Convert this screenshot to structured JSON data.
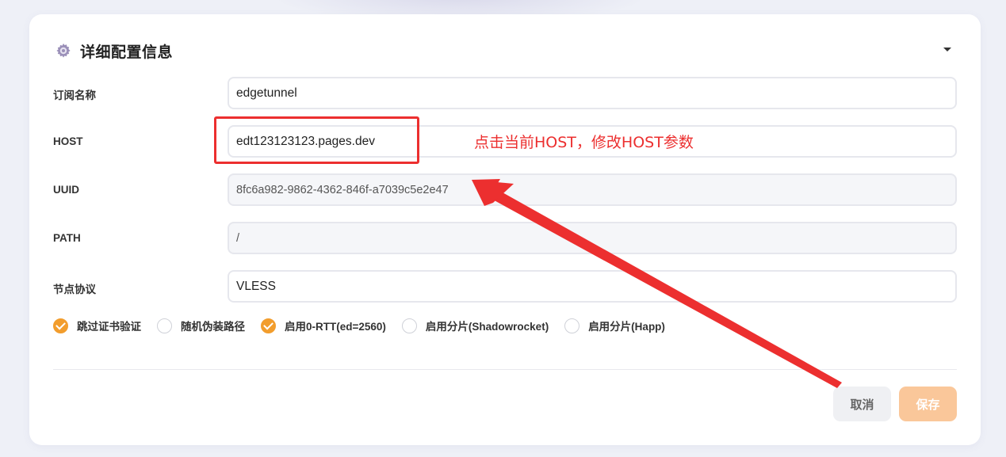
{
  "header": {
    "title": "详细配置信息",
    "icon": "gear-icon",
    "collapse_icon": "chevron-down-icon"
  },
  "form": {
    "subscription_name": {
      "label": "订阅名称",
      "value": "edgetunnel"
    },
    "host": {
      "label": "HOST",
      "value": "edt123123123.pages.dev"
    },
    "uuid": {
      "label": "UUID",
      "value": "8fc6a982-9862-4362-846f-a7039c5e2e47"
    },
    "path": {
      "label": "PATH",
      "value": "/"
    },
    "protocol": {
      "label": "节点协议",
      "value": "VLESS"
    }
  },
  "options": [
    {
      "label": "跳过证书验证",
      "checked": true
    },
    {
      "label": "随机伪装路径",
      "checked": false
    },
    {
      "label": "启用0-RTT(ed=2560)",
      "checked": true
    },
    {
      "label": "启用分片(Shadowrocket)",
      "checked": false
    },
    {
      "label": "启用分片(Happ)",
      "checked": false
    }
  ],
  "actions": {
    "cancel_label": "取消",
    "save_label": "保存"
  },
  "annotation": {
    "text": "点击当前HOST，修改HOST参数",
    "color": "#ec2f2f"
  },
  "colors": {
    "accent": "#f29d2d",
    "save_button": "#fac79a"
  }
}
